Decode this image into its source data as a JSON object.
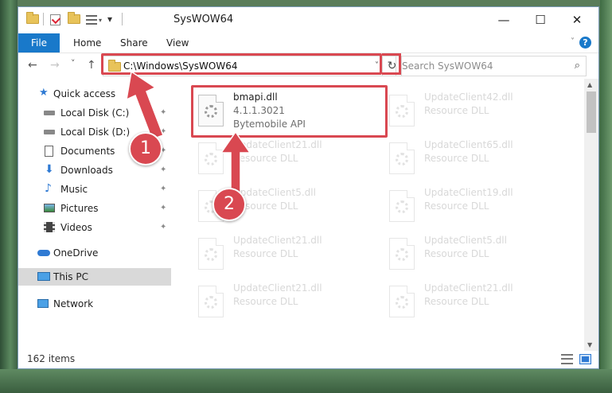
{
  "window": {
    "title": "SysWOW64",
    "controls": {
      "minimize": "—",
      "maximize": "☐",
      "close": "✕"
    }
  },
  "ribbon": {
    "tabs": [
      {
        "label": "File"
      },
      {
        "label": "Home"
      },
      {
        "label": "Share"
      },
      {
        "label": "View"
      }
    ],
    "help": "?"
  },
  "navbar": {
    "back": "←",
    "forward": "→",
    "recent": "˅",
    "up": "↑",
    "address": "C:\\Windows\\SysWOW64",
    "refresh": "↻",
    "search_placeholder": "Search SysWOW64",
    "search_icon": "⌕"
  },
  "sidebar": {
    "items": [
      {
        "label": "Quick access",
        "icon": "star-icon"
      },
      {
        "label": "Local Disk (C:)",
        "icon": "drive-icon"
      },
      {
        "label": "Local Disk (D:)",
        "icon": "drive-icon"
      },
      {
        "label": "Documents",
        "icon": "documents-icon"
      },
      {
        "label": "Downloads",
        "icon": "download-icon"
      },
      {
        "label": "Music",
        "icon": "music-icon"
      },
      {
        "label": "Pictures",
        "icon": "pictures-icon"
      },
      {
        "label": "Videos",
        "icon": "videos-icon"
      },
      {
        "label": "OneDrive",
        "icon": "cloud-icon"
      },
      {
        "label": "This PC",
        "icon": "computer-icon"
      },
      {
        "label": "Network",
        "icon": "network-icon"
      }
    ],
    "pin_glyph": "📌"
  },
  "files": [
    {
      "name": "bmapi.dll",
      "version": "4.1.1.3021",
      "desc": "Bytemobile API"
    },
    {
      "name": "UpdateClient42.dll",
      "desc": "Resource DLL"
    },
    {
      "name": "UpdateClient21.dll",
      "desc": "Resource DLL"
    },
    {
      "name": "UpdateClient65.dll",
      "desc": "Resource DLL"
    },
    {
      "name": "UpdateClient5.dll",
      "desc": "Resource DLL"
    },
    {
      "name": "UpdateClient19.dll",
      "desc": "Resource DLL"
    },
    {
      "name": "UpdateClient21.dll",
      "desc": "Resource DLL"
    },
    {
      "name": "UpdateClient5.dll",
      "desc": "Resource DLL"
    },
    {
      "name": "UpdateClient21.dll",
      "desc": "Resource DLL"
    },
    {
      "name": "UpdateClient21.dll",
      "desc": "Resource DLL"
    }
  ],
  "status": {
    "items": "162 items"
  },
  "annotations": {
    "badge1": "1",
    "badge2": "2"
  },
  "colors": {
    "accent": "#1979ca",
    "highlight": "#d94851",
    "selected": "#d9d9d9"
  }
}
